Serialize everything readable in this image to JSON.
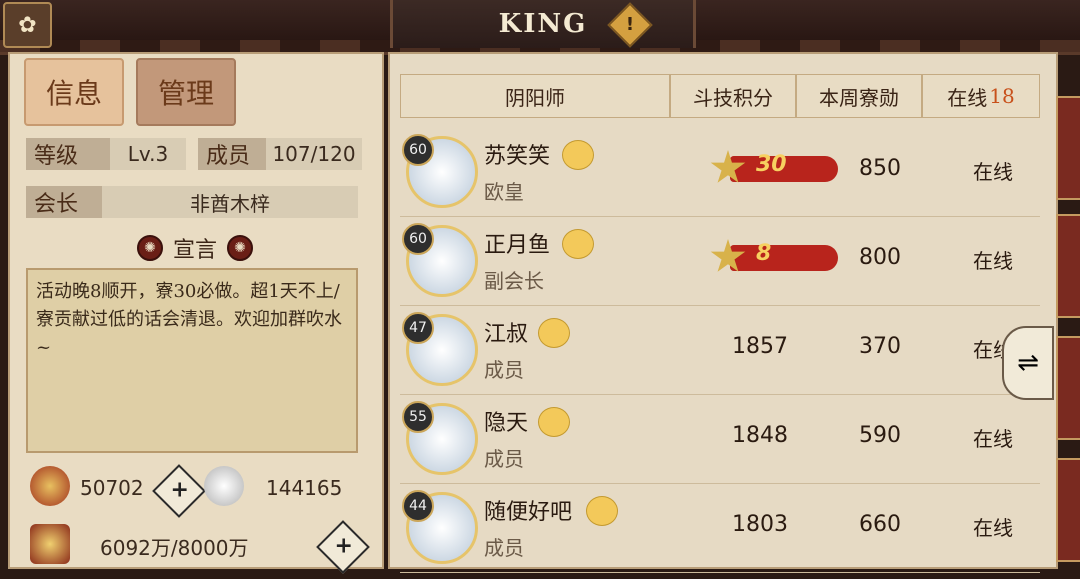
{
  "header": {
    "title": "KING",
    "alert_symbol": "!"
  },
  "tabs": {
    "info": "信息",
    "manage": "管理"
  },
  "guild": {
    "level_label": "等级",
    "level_value": "Lv.3",
    "members_label": "成员",
    "members_value": "107/120",
    "leader_label": "会长",
    "leader_value": "非酋木梓",
    "manifesto_title": "宣言",
    "manifesto_text": "活动晚8顺开，寮30必做。超1天不上/寮贡献过低的话会清退。欢迎加群吹水~"
  },
  "resources": {
    "coins": "50702",
    "materials": "144165",
    "funds": "6092万/8000万"
  },
  "table": {
    "col_name": "阴阳师",
    "col_score": "斗技积分",
    "col_weekly": "本周寮勋",
    "col_online_label": "在线",
    "col_online_count": "18",
    "rows": [
      {
        "level": "60",
        "name": "苏笑笑",
        "role": "欧皇",
        "rank": "30",
        "score": "",
        "weekly": "850",
        "status": "在线"
      },
      {
        "level": "60",
        "name": "正月鱼",
        "role": "副会长",
        "rank": "8",
        "score": "",
        "weekly": "800",
        "status": "在线"
      },
      {
        "level": "47",
        "name": "江叔",
        "role": "成员",
        "rank": "",
        "score": "1857",
        "weekly": "370",
        "status": "在线"
      },
      {
        "level": "55",
        "name": "隐天",
        "role": "成员",
        "rank": "",
        "score": "1848",
        "weekly": "590",
        "status": "在线"
      },
      {
        "level": "44",
        "name": "随便好吧",
        "role": "成员",
        "rank": "",
        "score": "1803",
        "weekly": "660",
        "status": "在线"
      }
    ]
  },
  "colors": {
    "accent_red": "#b8241c",
    "online_count": "#c8501a",
    "parchment": "#e6dac4"
  },
  "icons": [
    "guild-emblem-icon",
    "alert-icon",
    "swirl-icon",
    "coin-icon",
    "material-icon",
    "fund-icon",
    "plus-icon",
    "chick-icon",
    "rank-star-icon",
    "swap-icon"
  ]
}
